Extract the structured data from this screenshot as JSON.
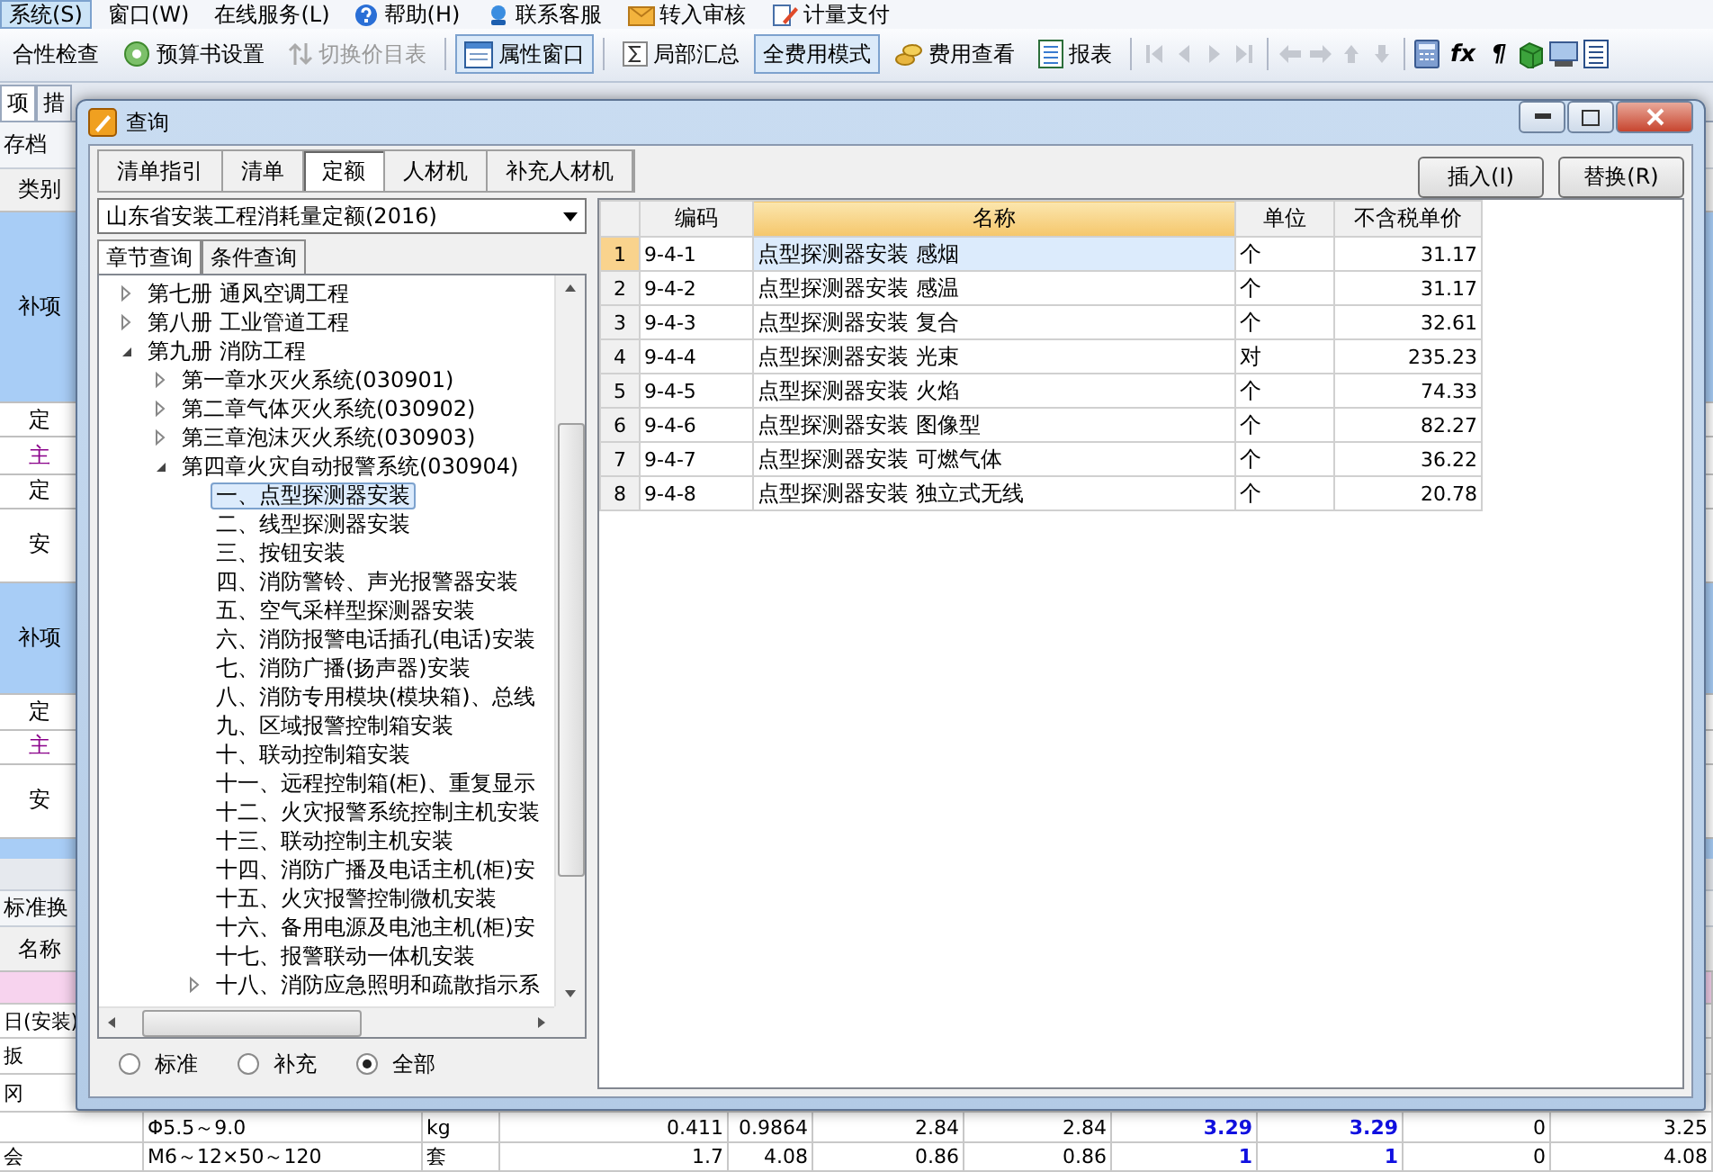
{
  "menu_bar": {
    "items": [
      {
        "label": "系统(S)",
        "selected": true
      },
      {
        "label": "窗口(W)",
        "selected": false
      },
      {
        "label": "在线服务(L)",
        "selected": false
      },
      {
        "label": "帮助(H)",
        "selected": false
      },
      {
        "label": "联系客服",
        "selected": false
      },
      {
        "label": "转入审核",
        "selected": false
      },
      {
        "label": "计量支付",
        "selected": false
      }
    ]
  },
  "toolbar": {
    "buttons": [
      {
        "label": "合性检查",
        "pressed": false,
        "disabled": false
      },
      {
        "label": "预算书设置",
        "pressed": false,
        "disabled": false
      },
      {
        "label": "切换价目表",
        "pressed": false,
        "disabled": true
      },
      {
        "label": "属性窗口",
        "pressed": true,
        "disabled": false
      },
      {
        "label": "局部汇总",
        "pressed": false,
        "disabled": false
      },
      {
        "label": "全费用模式",
        "pressed": true,
        "disabled": false
      },
      {
        "label": "费用查看",
        "pressed": false,
        "disabled": false
      },
      {
        "label": "报表",
        "pressed": false,
        "disabled": false
      }
    ],
    "symbols": [
      "fx",
      "¶"
    ]
  },
  "doc_tabs": [
    {
      "label": "项",
      "selected": true
    },
    {
      "label": "措",
      "selected": false
    }
  ],
  "archive_bar": {
    "label": "存档"
  },
  "category_table": {
    "header": "类别",
    "rows": [
      {
        "label": "补项",
        "kind": "item"
      },
      {
        "label": "定",
        "kind": "quota"
      },
      {
        "label": "主",
        "kind": "main"
      },
      {
        "label": "定",
        "kind": "quota"
      },
      {
        "label": "安",
        "kind": "install"
      },
      {
        "label": "补项",
        "kind": "item"
      },
      {
        "label": "定",
        "kind": "quota"
      },
      {
        "label": "主",
        "kind": "main"
      },
      {
        "label": "安",
        "kind": "install"
      }
    ]
  },
  "lower_panel": {
    "title": "标准换",
    "header": "名称",
    "rows": [
      {
        "selected": true
      },
      {
        "name": "日(安装)",
        "selected": false
      },
      {
        "name": "扳",
        "selected": false
      },
      {
        "name": "冈",
        "selected": false
      },
      {
        "cells": [
          "Φ5.5～9.0",
          "kg",
          "0.411",
          "0.9864",
          "2.84",
          "2.84",
          "3.29",
          "3.29",
          "0",
          "3.25"
        ],
        "selected": false
      },
      {
        "name": "会",
        "cells": [
          "M6～12×50～120",
          "套",
          "1.7",
          "4.08",
          "0.86",
          "0.86",
          "1",
          "1",
          "0",
          "4.08"
        ],
        "selected": false
      }
    ]
  },
  "dialog": {
    "title": "查询",
    "tabs": [
      {
        "label": "清单指引",
        "selected": false
      },
      {
        "label": "清单",
        "selected": false
      },
      {
        "label": "定额",
        "selected": true
      },
      {
        "label": "人材机",
        "selected": false
      },
      {
        "label": "补充人材机",
        "selected": false
      }
    ],
    "buttons": [
      "插入(I)",
      "替换(R)"
    ],
    "library": "山东省安装工程消耗量定额(2016)",
    "query_tabs": [
      {
        "label": "章节查询",
        "selected": true
      },
      {
        "label": "条件查询",
        "selected": false
      }
    ],
    "tree": [
      {
        "label": "第七册 通风空调工程",
        "expanded": false,
        "selected": false
      },
      {
        "label": "第八册 工业管道工程",
        "expanded": false,
        "selected": false
      },
      {
        "label": "第九册 消防工程",
        "expanded": true,
        "selected": false,
        "children": [
          {
            "label": "第一章水灭火系统(030901)",
            "expanded": false,
            "selected": false
          },
          {
            "label": "第二章气体灭火系统(030902)",
            "expanded": false,
            "selected": false
          },
          {
            "label": "第三章泡沫灭火系统(030903)",
            "expanded": false,
            "selected": false
          },
          {
            "label": "第四章火灾自动报警系统(030904)",
            "expanded": true,
            "selected": false,
            "children": [
              {
                "label": "一、点型探测器安装",
                "selected": true
              },
              {
                "label": "二、线型探测器安装",
                "selected": false
              },
              {
                "label": "三、按钮安装",
                "selected": false
              },
              {
                "label": "四、消防警铃、声光报警器安装",
                "selected": false
              },
              {
                "label": "五、空气采样型探测器安装",
                "selected": false
              },
              {
                "label": "六、消防报警电话插孔(电话)安装",
                "selected": false
              },
              {
                "label": "七、消防广播(扬声器)安装",
                "selected": false
              },
              {
                "label": "八、消防专用模块(模块箱)、总线",
                "selected": false
              },
              {
                "label": "九、区域报警控制箱安装",
                "selected": false
              },
              {
                "label": "十、联动控制箱安装",
                "selected": false
              },
              {
                "label": "十一、远程控制箱(柜)、重复显示",
                "selected": false
              },
              {
                "label": "十二、火灾报警系统控制主机安装",
                "selected": false
              },
              {
                "label": "十三、联动控制主机安装",
                "selected": false
              },
              {
                "label": "十四、消防广播及电话主机(柜)安",
                "selected": false
              },
              {
                "label": "十五、火灾报警控制微机安装",
                "selected": false
              },
              {
                "label": "十六、备用电源及电池主机(柜)安",
                "selected": false
              },
              {
                "label": "十七、报警联动一体机安装",
                "selected": false
              },
              {
                "label": "十八、消防应急照明和疏散指示系",
                "expanded": false,
                "selected": false
              }
            ]
          }
        ]
      }
    ],
    "filter": [
      {
        "label": "标准",
        "selected": false
      },
      {
        "label": "补充",
        "selected": false
      },
      {
        "label": "全部",
        "selected": true
      }
    ],
    "table": {
      "columns": [
        {
          "label": "编码",
          "selected": false
        },
        {
          "label": "名称",
          "selected": true
        },
        {
          "label": "单位",
          "selected": false
        },
        {
          "label": "不含税单价",
          "selected": false
        }
      ],
      "rows": [
        {
          "number": "1",
          "code": "9-4-1",
          "name": "点型探测器安装 感烟",
          "unit": "个",
          "price": "31.17",
          "selected": true
        },
        {
          "number": "2",
          "code": "9-4-2",
          "name": "点型探测器安装 感温",
          "unit": "个",
          "price": "31.17",
          "selected": false
        },
        {
          "number": "3",
          "code": "9-4-3",
          "name": "点型探测器安装 复合",
          "unit": "个",
          "price": "32.61",
          "selected": false
        },
        {
          "number": "4",
          "code": "9-4-4",
          "name": "点型探测器安装 光束",
          "unit": "对",
          "price": "235.23",
          "selected": false
        },
        {
          "number": "5",
          "code": "9-4-5",
          "name": "点型探测器安装 火焰",
          "unit": "个",
          "price": "74.33",
          "selected": false
        },
        {
          "number": "6",
          "code": "9-4-6",
          "name": "点型探测器安装 图像型",
          "unit": "个",
          "price": "82.27",
          "selected": false
        },
        {
          "number": "7",
          "code": "9-4-7",
          "name": "点型探测器安装 可燃气体",
          "unit": "个",
          "price": "36.22",
          "selected": false
        },
        {
          "number": "8",
          "code": "9-4-8",
          "name": "点型探测器安装 独立式无线",
          "unit": "个",
          "price": "20.78",
          "selected": false
        }
      ]
    }
  }
}
